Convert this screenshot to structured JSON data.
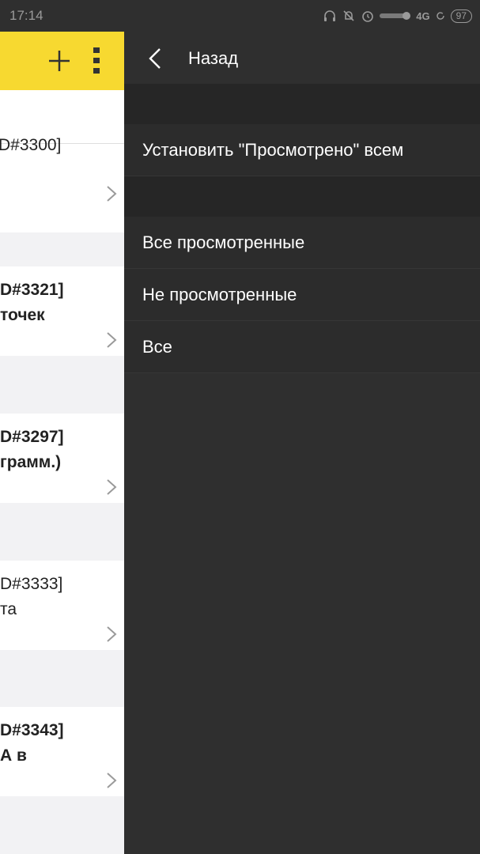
{
  "status_bar": {
    "time": "17:14",
    "network": "4G",
    "battery": "97",
    "icons": [
      "headphones-icon",
      "bell-off-icon",
      "alarm-icon",
      "signal-icon",
      "sync-icon",
      "battery-icon"
    ]
  },
  "left_panel": {
    "header": {
      "color": "#f7d930",
      "icons": [
        "plus-icon",
        "more-vertical-icon"
      ]
    },
    "first_card": {
      "line": "D#3300]"
    },
    "cards": [
      {
        "line1": "D#3321]",
        "line2": "точек",
        "bold": true
      },
      {
        "line1": "D#3297]",
        "line2": "грамм.)",
        "bold": true
      },
      {
        "line1": "D#3333]",
        "line2": "та",
        "bold": false
      },
      {
        "line1": "D#3343]",
        "line2": "А в",
        "bold": true
      }
    ]
  },
  "menu": {
    "back_label": "Назад",
    "actions": [
      {
        "label": "Установить \"Просмотрено\" всем"
      }
    ],
    "filters": [
      {
        "label": "Все просмотренные"
      },
      {
        "label": "Не просмотренные"
      },
      {
        "label": "Все"
      }
    ]
  }
}
